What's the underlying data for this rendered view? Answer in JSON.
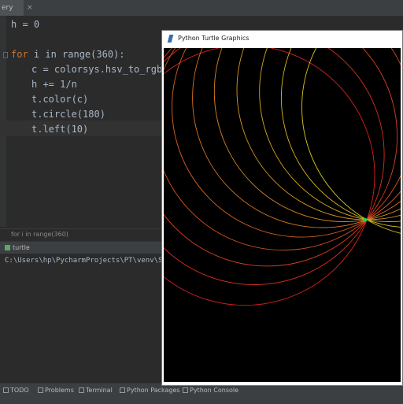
{
  "editor": {
    "tab_label": "ery",
    "tab_close": "×",
    "lines": [
      {
        "pre": "",
        "kw": "",
        "text": "h = 0"
      },
      {
        "pre": "",
        "kw": "for",
        "text": " i in range(360):"
      },
      {
        "pre": "    ",
        "kw": "",
        "text": "c = colorsys.hsv_to_rgb("
      },
      {
        "pre": "    ",
        "kw": "",
        "text": "h += 1/n"
      },
      {
        "pre": "    ",
        "kw": "",
        "text": "t.color(c)"
      },
      {
        "pre": "    ",
        "kw": "",
        "text": "t.circle(180)"
      },
      {
        "pre": "    ",
        "kw": "",
        "text": "t.left(10)"
      }
    ],
    "breadcrumb": "for i in range(360)"
  },
  "run_panel": {
    "tab_label": "turtle",
    "console_path": "C:\\Users\\hp\\PycharmProjects\\PT\\venv\\Sc"
  },
  "status_tools": [
    {
      "label": "TODO",
      "icon": "list-icon"
    },
    {
      "label": "Problems",
      "icon": "problems-icon"
    },
    {
      "label": "Terminal",
      "icon": "terminal-icon"
    },
    {
      "label": "Python Packages",
      "icon": "packages-icon"
    },
    {
      "label": "Python Console",
      "icon": "console-icon"
    }
  ],
  "turtle_window": {
    "title": "Python Turtle Graphics",
    "background": "#000000",
    "circle_count": 11
  }
}
